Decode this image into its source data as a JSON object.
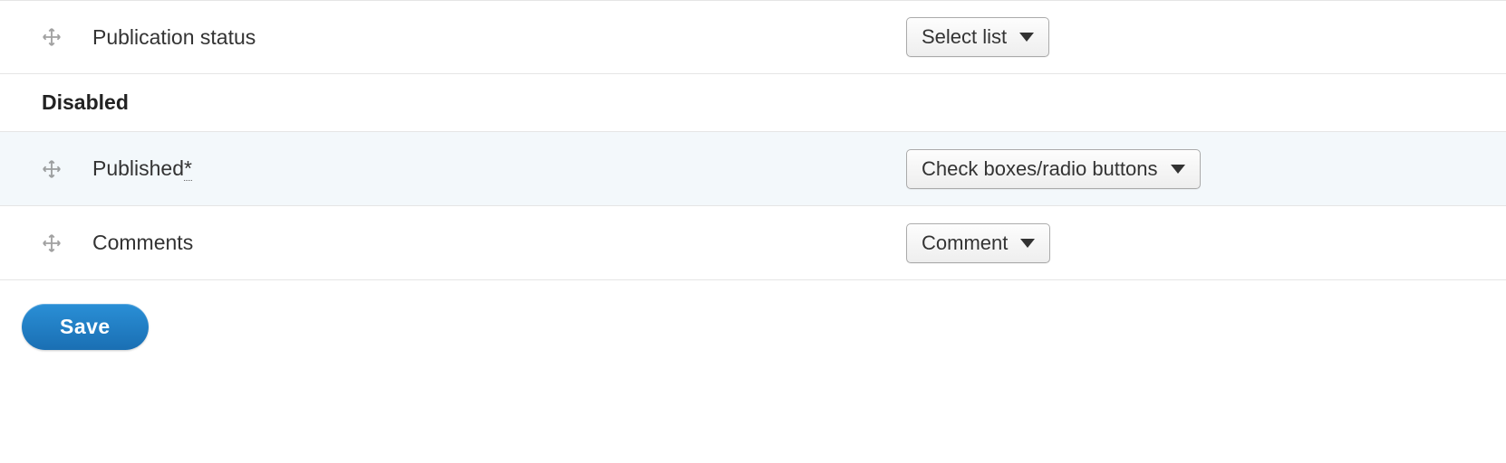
{
  "rows": [
    {
      "label": "Publication status",
      "asterisk": "",
      "widget": "Select list",
      "highlighted": false
    },
    {
      "label": "Published",
      "asterisk": "*",
      "widget": "Check boxes/radio buttons",
      "highlighted": true
    },
    {
      "label": "Comments",
      "asterisk": "",
      "widget": "Comment",
      "highlighted": false
    }
  ],
  "section_header": "Disabled",
  "actions": {
    "save_label": "Save"
  }
}
